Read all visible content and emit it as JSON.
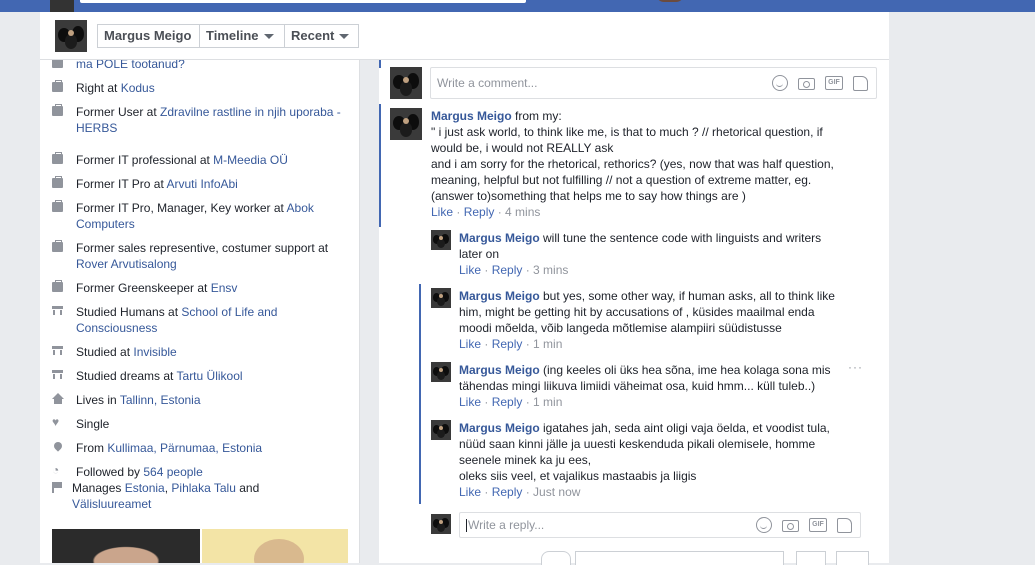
{
  "header": {
    "name": "Margus Meigo",
    "timeline_label": "Timeline",
    "recent_label": "Recent"
  },
  "intro": {
    "items": [
      {
        "icon": "briefcase-icon",
        "pre": "",
        "link": "ma POLE tootanud?",
        "post": ""
      },
      {
        "icon": "briefcase-icon",
        "pre": "Right at ",
        "link": "Kodus",
        "post": ""
      },
      {
        "icon": "briefcase-icon",
        "pre": "Former User at ",
        "link": "Zdravilne rastline in njih uporaba - HERBS",
        "post": ""
      },
      {
        "icon": "briefcase-icon",
        "pre": "Former IT professional at ",
        "link": "M-Meedia OÜ",
        "post": ""
      },
      {
        "icon": "briefcase-icon",
        "pre": "Former IT Pro at ",
        "link": "Arvuti InfoAbi",
        "post": ""
      },
      {
        "icon": "briefcase-icon",
        "pre": "Former IT Pro, Manager, Key worker at ",
        "link": "Abok Computers",
        "post": ""
      },
      {
        "icon": "briefcase-icon",
        "pre": "Former sales representive, costumer support at ",
        "link": "Rover Arvutisalong",
        "post": ""
      },
      {
        "icon": "briefcase-icon",
        "pre": "Former Greenskeeper at ",
        "link": "Ensv",
        "post": ""
      },
      {
        "icon": "school-icon",
        "pre": "Studied Humans at ",
        "link": "School of Life and Consciousness",
        "post": ""
      },
      {
        "icon": "school-icon",
        "pre": "Studied at ",
        "link": "Invisible",
        "post": ""
      },
      {
        "icon": "school-icon",
        "pre": "Studied dreams at ",
        "link": "Tartu Ülikool",
        "post": ""
      },
      {
        "icon": "home-icon",
        "pre": "Lives in ",
        "link": "Tallinn, Estonia",
        "post": ""
      },
      {
        "icon": "heart-icon",
        "pre": "Single",
        "link": "",
        "post": ""
      },
      {
        "icon": "location-pin-icon",
        "pre": "From ",
        "link": "Kullimaa, Pärnumaa, Estonia",
        "post": ""
      },
      {
        "icon": "rss-icon",
        "pre": "Followed by ",
        "link": "564 people",
        "post": ""
      }
    ],
    "manages": {
      "pre": "Manages ",
      "link1": "Estonia",
      "sep": ", ",
      "link2": "Pihlaka Talu",
      "and": " and",
      "link3": "Välisluureamet"
    }
  },
  "comment_box": {
    "placeholder": "Write a comment..."
  },
  "reply_box": {
    "placeholder": "Write a reply..."
  },
  "actions": {
    "like": "Like",
    "reply": "Reply",
    "sep": " · "
  },
  "comments": [
    {
      "author": "Margus Meigo",
      "lead": " from my:",
      "lines": [
        "\" i just ask world, to think like me, is that to much ? // rhetorical question, if",
        "would be, i would not REALLY ask",
        "and i am sorry for the rhetorical, rethorics? (yes, now that was half question,",
        "meaning, helpful but not fulfilling // not a question of extreme matter, eg.",
        "(answer to)something that helps me to say how things are )"
      ],
      "time": "4 mins"
    },
    {
      "author": "Margus Meigo",
      "lead": " will tune the sentence code with linguists and writers",
      "lines": [
        "later on"
      ],
      "time": "3 mins"
    },
    {
      "author": "Margus Meigo",
      "lead": " but yes, some other way, if human asks, all to think like",
      "lines": [
        "him, might be getting hit by accusations of , küsides maailmal enda",
        "moodi mõelda, võib langeda mõtlemise alampiiri süüdistusse"
      ],
      "time": "1 min"
    },
    {
      "author": "Margus Meigo",
      "lead": " (ing keeles oli üks hea sõna, ime hea kolaga sona mis",
      "lines": [
        "tähendas mingi liikuva limiidi väheimat osa, kuid hmm... küll tuleb..)"
      ],
      "time": "1 min"
    },
    {
      "author": "Margus Meigo",
      "lead": " igatahes jah, seda aint oligi vaja öelda, et voodist tula,",
      "lines": [
        "nüüd saan kinni jälle ja uuesti keskenduda pikali olemisele, homme",
        "seenele minek ka ju ees,",
        "oleks siis veel, et vajalikus mastaabis ja liigis"
      ],
      "time": "Just now"
    }
  ]
}
